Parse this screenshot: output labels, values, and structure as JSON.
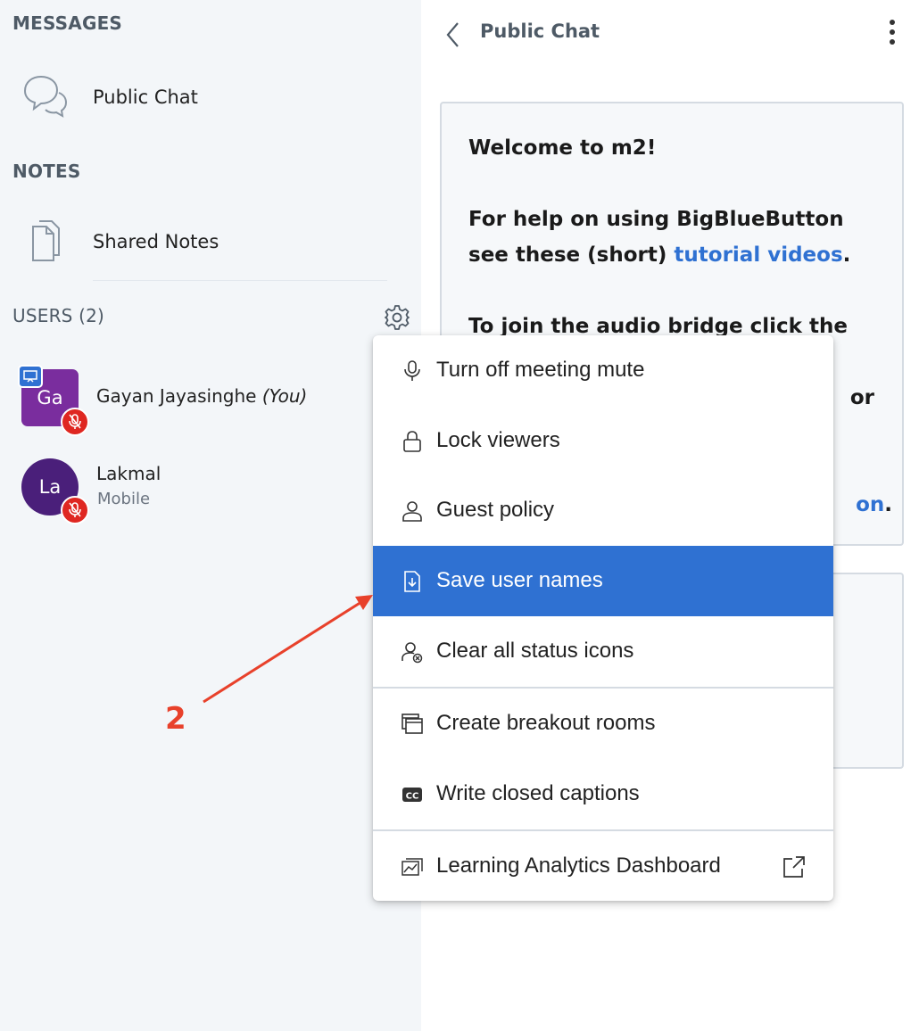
{
  "sidebar": {
    "messages_title": "MESSAGES",
    "public_chat_label": "Public Chat",
    "notes_title": "NOTES",
    "shared_notes_label": "Shared Notes",
    "users_title": "USERS (2)"
  },
  "users": [
    {
      "initials": "Ga",
      "name": "Gayan Jayasinghe",
      "you_tag": "(You)",
      "subtitle": "",
      "presenter": true
    },
    {
      "initials": "La",
      "name": "Lakmal",
      "you_tag": "",
      "subtitle": "Mobile",
      "presenter": false
    }
  ],
  "chat": {
    "title": "Public Chat",
    "welcome": "Welcome to m2!",
    "help_prefix": "For help on using BigBlueButton see these (short) ",
    "help_link": "tutorial videos",
    "help_suffix": ".",
    "audio_line": "To join the audio bridge click the",
    "hidden_fragment": "or",
    "hidden_link_fragment": "on",
    "hidden_suffix": "."
  },
  "menu": {
    "items": [
      {
        "label": "Turn off meeting mute",
        "icon": "microphone-icon"
      },
      {
        "label": "Lock viewers",
        "icon": "lock-icon"
      },
      {
        "label": "Guest policy",
        "icon": "user-icon"
      },
      {
        "label": "Save user names",
        "icon": "download-file-icon",
        "active": true
      },
      {
        "label": "Clear all status icons",
        "icon": "clear-status-icon"
      },
      {
        "label": "Create breakout rooms",
        "icon": "rooms-icon"
      },
      {
        "label": "Write closed captions",
        "icon": "cc-icon"
      },
      {
        "label": "Learning Analytics Dashboard",
        "icon": "analytics-icon"
      }
    ]
  },
  "annotation": {
    "number": "2"
  },
  "colors": {
    "accent": "#2f71d2",
    "mute_red": "#df2721",
    "annotation_red": "#e8412b",
    "sidebar_bg": "#f3f6f9"
  }
}
